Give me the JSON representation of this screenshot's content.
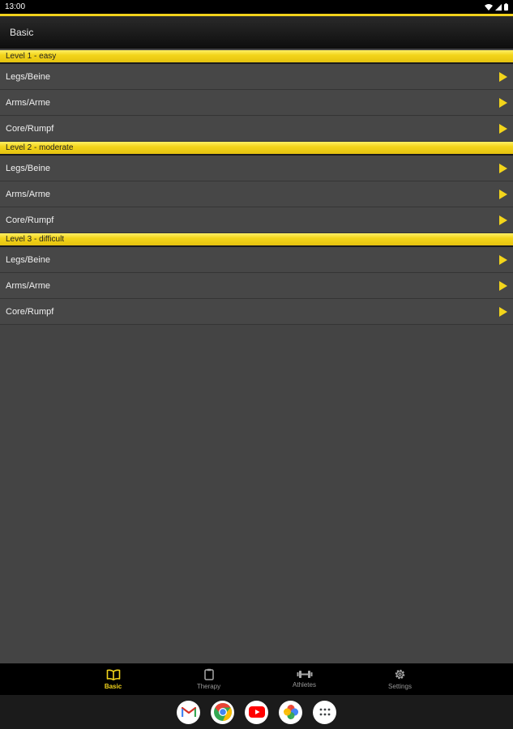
{
  "status_bar": {
    "time": "13:00"
  },
  "app_bar": {
    "title": "Basic"
  },
  "sections": [
    {
      "header": "Level 1 - easy",
      "items": [
        "Legs/Beine",
        "Arms/Arme",
        "Core/Rumpf"
      ]
    },
    {
      "header": "Level 2 - moderate",
      "items": [
        "Legs/Beine",
        "Arms/Arme",
        "Core/Rumpf"
      ]
    },
    {
      "header": "Level 3 - difficult",
      "items": [
        "Legs/Beine",
        "Arms/Arme",
        "Core/Rumpf"
      ]
    }
  ],
  "bottom_nav": {
    "active": "Basic",
    "items": [
      {
        "label": "Basic",
        "icon": "book-icon"
      },
      {
        "label": "Therapy",
        "icon": "clipboard-icon"
      },
      {
        "label": "Athletes",
        "icon": "dumbbell-icon"
      },
      {
        "label": "Settings",
        "icon": "gear-icon"
      }
    ]
  },
  "dock": {
    "apps": [
      "gmail-icon",
      "chrome-icon",
      "youtube-icon",
      "photos-icon",
      "app-drawer-icon"
    ]
  },
  "colors": {
    "accent": "#f3d51b",
    "background": "#444444",
    "nav_background": "#000000"
  }
}
